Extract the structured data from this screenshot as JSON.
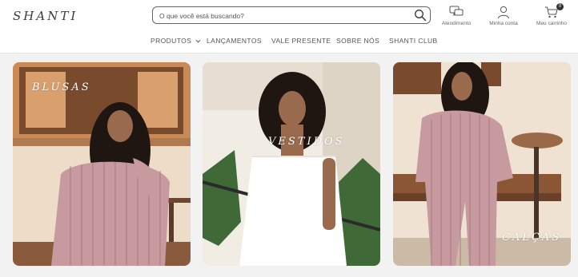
{
  "header": {
    "logo_text": "SHANTI",
    "search": {
      "placeholder": "O que você está buscando?",
      "value": ""
    },
    "actions": [
      {
        "label": "Atendimento",
        "icon": "chat-icon"
      },
      {
        "label": "Minha conta",
        "icon": "user-icon"
      },
      {
        "label": "Meu carrinho",
        "icon": "cart-icon",
        "badge": "0"
      }
    ]
  },
  "nav": {
    "items": [
      {
        "label": "PRODUTOS",
        "has_dropdown": true
      },
      {
        "label": "LANÇAMENTOS"
      },
      {
        "label": "VALE PRESENTE"
      },
      {
        "label": "SOBRE NÓS"
      },
      {
        "label": "SHANTI CLUB"
      }
    ]
  },
  "categories": [
    {
      "label": "BLUSAS"
    },
    {
      "label": "VESTIDOS"
    },
    {
      "label": "CALÇAS"
    }
  ],
  "colors": {
    "accent_dark": "#333333",
    "page_bg": "#f2f2f2",
    "stripe_pink": "#c79aa0",
    "wall_cream": "#efe2d2",
    "wood_brown": "#7a4a2c"
  }
}
